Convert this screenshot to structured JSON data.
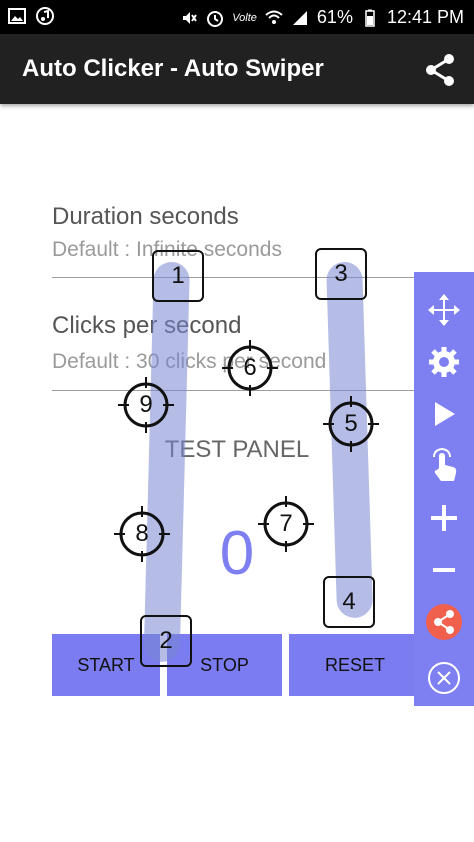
{
  "status_bar": {
    "battery": "61%",
    "time": "12:41 PM",
    "network": "Volte"
  },
  "app_bar": {
    "title": "Auto Clicker - Auto Swiper"
  },
  "fields": {
    "duration": {
      "title": "Duration seconds",
      "placeholder": "Default : Infinite seconds"
    },
    "clicks": {
      "title": "Clicks per second",
      "placeholder": "Default : 30 clicks per second"
    }
  },
  "test_panel": {
    "label": "TEST PANEL",
    "count": "0"
  },
  "buttons": {
    "start": "START",
    "stop": "STOP",
    "reset": "RESET"
  },
  "swipe_points": [
    "1",
    "2",
    "3",
    "4"
  ],
  "click_targets": [
    "5",
    "6",
    "7",
    "8",
    "9"
  ],
  "side_panel": {
    "icons": [
      "move-icon",
      "settings-icon",
      "play-icon",
      "touch-icon",
      "add-icon",
      "remove-icon",
      "share-icon",
      "close-icon"
    ],
    "accent": "#7e7ff0",
    "share_accent": "#f0604d"
  }
}
